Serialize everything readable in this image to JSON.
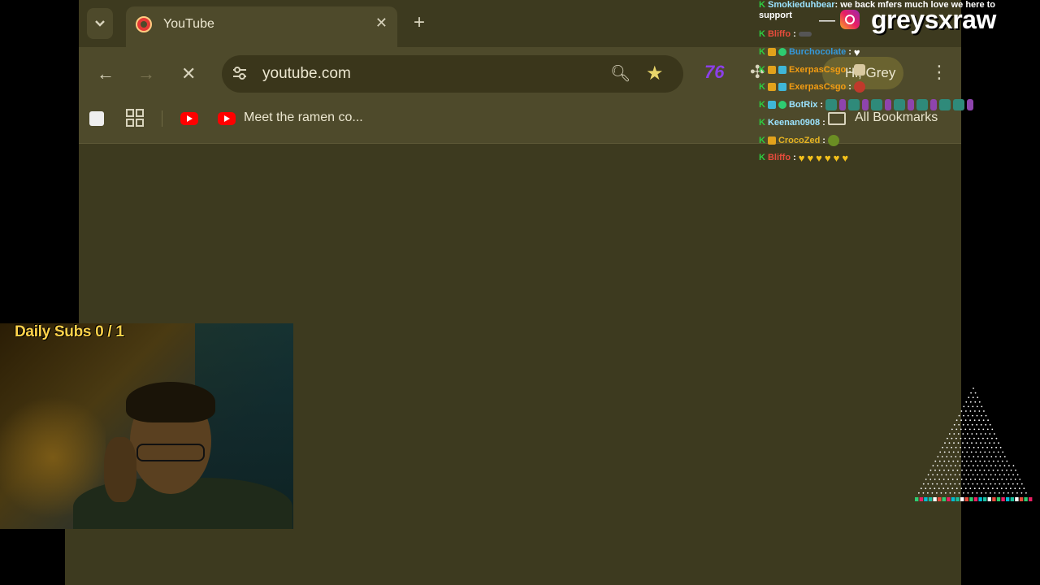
{
  "browser": {
    "tab": {
      "title": "YouTube"
    },
    "omnibox": {
      "url": "youtube.com"
    },
    "profile": {
      "label": "Hi, Grey"
    },
    "bookmarks": {
      "item_label": "Meet the ramen co...",
      "all_label": "All Bookmarks"
    },
    "colors": {
      "frame": "#3d3a1f",
      "toolbar": "#4e4a2b",
      "accent_star": "#e8d56a"
    },
    "icons": [
      "tab-list-icon",
      "close-icon",
      "new-tab-icon",
      "back-icon",
      "forward-icon",
      "stop-icon",
      "site-settings-icon",
      "zoom-icon",
      "star-icon",
      "extension-icon",
      "puzzle-icon",
      "menu-icon",
      "apps-icon",
      "youtube-icon",
      "folder-icon"
    ]
  },
  "overlay": {
    "daily_subs": "Daily Subs  0 / 1",
    "instagram_handle": "greysxraw",
    "chat": {
      "first": {
        "user": "Smokieduhbear",
        "text": ": we back mfers much love we here to support"
      },
      "lines": [
        {
          "user": "Bliffo",
          "text": ":",
          "color": "#e74c3c"
        },
        {
          "user": "Burchocolate",
          "text": ":",
          "color": "#3498db"
        },
        {
          "user": "ExerpasCsgo",
          "text": ":",
          "color": "#f39c12"
        },
        {
          "user": "ExerpasCsgo",
          "text": ":",
          "color": "#f39c12"
        },
        {
          "user": "BotRix",
          "text": ":",
          "color": "#9be3ff"
        },
        {
          "user": "Keenan0908",
          "text": ":",
          "color": "#9be3ff"
        },
        {
          "user": "CrocoZed",
          "text": ":",
          "color": "#e6b422"
        },
        {
          "user": "Bliffo",
          "text": ":",
          "color": "#e74c3c"
        }
      ]
    }
  }
}
